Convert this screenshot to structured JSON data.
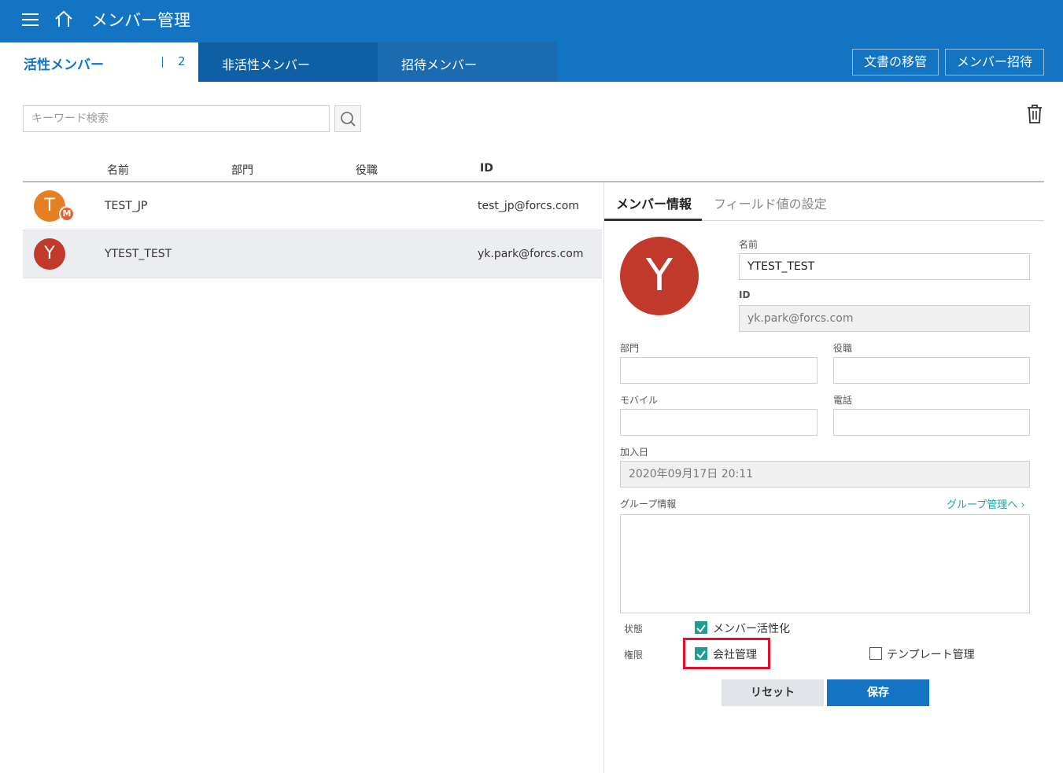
{
  "header": {
    "title": "メンバー管理"
  },
  "tabs": {
    "active_label": "活性メンバー",
    "active_count": "2",
    "inactive_label": "非活性メンバー",
    "invited_label": "招待メンバー"
  },
  "header_buttons": {
    "transfer": "文書の移管",
    "invite": "メンバー招待"
  },
  "search": {
    "placeholder": "キーワード検索"
  },
  "table": {
    "columns": {
      "name": "名前",
      "dept": "部門",
      "position": "役職",
      "id": "ID"
    },
    "rows": [
      {
        "initial": "T",
        "badge": "M",
        "name": "TEST_JP",
        "id": "test_jp@forcs.com",
        "avatar_color": "#e67e22"
      },
      {
        "initial": "Y",
        "name": "YTEST_TEST",
        "id": "yk.park@forcs.com",
        "avatar_color": "#c0392b"
      }
    ]
  },
  "panel": {
    "tab_info": "メンバー情報",
    "tab_fields": "フィールド値の設定",
    "avatar_initial": "Y",
    "name_label": "名前",
    "name_value": "YTEST_TEST",
    "id_label": "ID",
    "id_value": "yk.park@forcs.com",
    "dept_label": "部門",
    "position_label": "役職",
    "mobile_label": "モバイル",
    "phone_label": "電話",
    "joined_label": "加入日",
    "joined_value": "2020年09月17日 20:11",
    "group_label": "グループ情報",
    "group_link": "グループ管理へ",
    "status_label": "状態",
    "status_option": "メンバー活性化",
    "permission_label": "権限",
    "perm_company": "会社管理",
    "perm_template": "テンプレート管理",
    "reset_label": "リセット",
    "save_label": "保存"
  },
  "colors": {
    "brand": "#1274c3",
    "accent": "#1f9e90",
    "highlight": "#e0102a"
  }
}
